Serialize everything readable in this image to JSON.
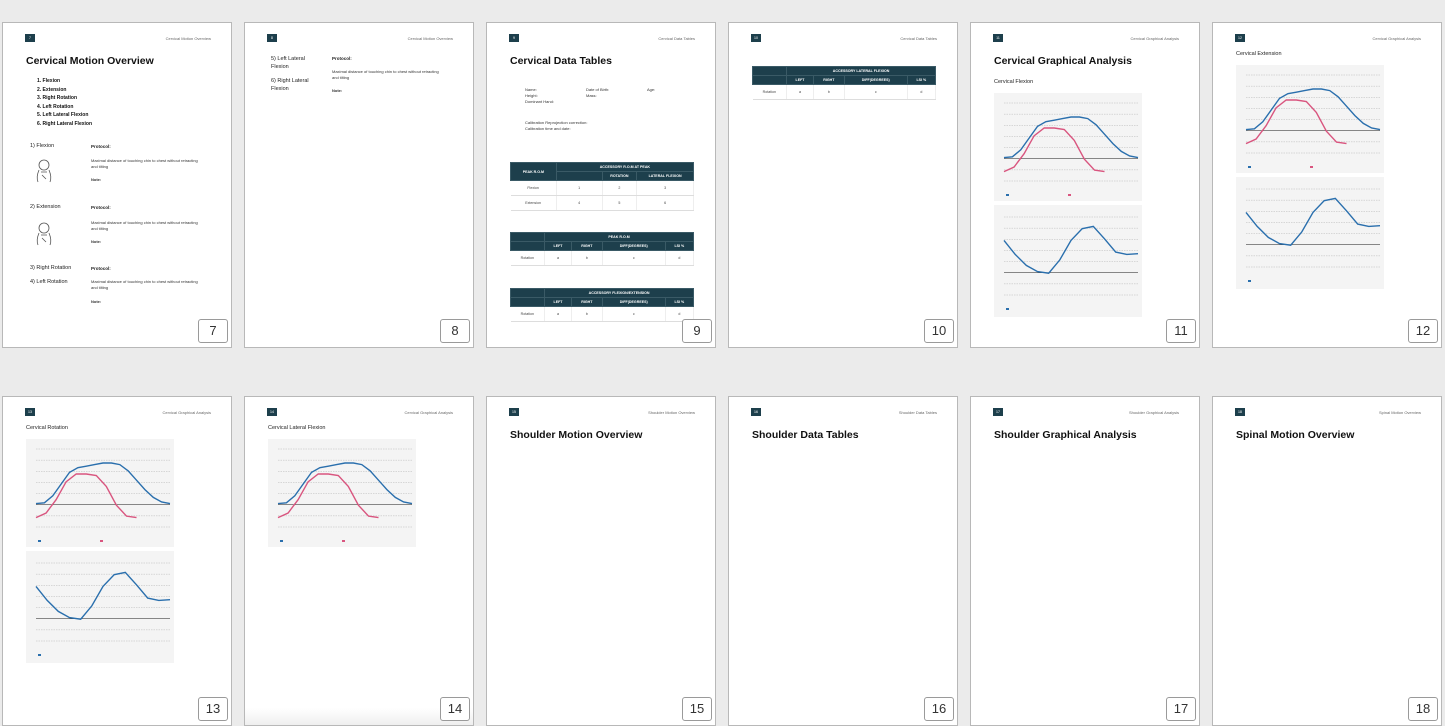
{
  "pages": [
    {
      "num": "7",
      "header": "Cervical Motion Overview",
      "title": "Cervical Motion Overview",
      "list": [
        "1.  Flexion",
        "2.  Extension",
        "3.  Right Rotation",
        "4.  Left Rotation",
        "5.  Left Lateral Flexion",
        "6.  Right Lateral Flexion"
      ],
      "sections": [
        {
          "label": "1) Flexion",
          "protocol": "Protocol:",
          "desc": "Maximal distance of touching chin to chest without retracting and tilting",
          "note": "Note:"
        },
        {
          "label": "2) Extension",
          "protocol": "Protocol:",
          "desc": "Maximal distance of touching chin to chest without retracting and tilting",
          "note": "Note:"
        },
        {
          "label": "3) Right Rotation",
          "protocol": "Protocol:"
        },
        {
          "label": "4) Left Rotation",
          "desc": "Maximal distance of touching chin to chest without retracting and tilting",
          "note": "Note:"
        }
      ]
    },
    {
      "num": "8",
      "header": "Cervical Motion Overview",
      "sections": [
        {
          "label": "5) Left Lateral Flexion",
          "protocol": "Protocol:",
          "desc": "Maximal distance of touching chin to chest without retracting and tilting"
        },
        {
          "label": "6) Right Lateral Flexion",
          "note": "Note:"
        }
      ]
    },
    {
      "num": "9",
      "header": "Cervical Data Tables",
      "title": "Cervical Data Tables",
      "info": {
        "name": "Name:",
        "height": "Height:",
        "dominant": "Dominant Hand:",
        "dob": "Date of Birth:",
        "mass": "Mass:",
        "age": "Age:",
        "calib1": "Calibration Reprojection correction:",
        "calib2": "Calibration time and date:"
      },
      "table1": {
        "h1": "PEAK R.O.M",
        "h2": "ACCESSORY R.O.M AT PEAK",
        "h3": "ROTATION",
        "h4": "LATERAL FLEXION",
        "rows": [
          [
            "Flexion",
            "1",
            "2",
            "3"
          ],
          [
            "Extension",
            "4",
            "5",
            "6"
          ]
        ]
      },
      "table2": {
        "caption": "PEAK R.O.M",
        "cols": [
          "LEFT",
          "RIGHT",
          "DIFF(DEGREES)",
          "LSI %"
        ],
        "row": [
          "Rotation",
          "a",
          "b",
          "c",
          "d"
        ]
      },
      "table3": {
        "caption": "ACCESSORY FLEXION/EXTENSION",
        "cols": [
          "LEFT",
          "RIGHT",
          "DIFF(DEGREES)",
          "LSI %"
        ],
        "row": [
          "Rotation",
          "a",
          "b",
          "c",
          "d"
        ]
      }
    },
    {
      "num": "10",
      "header": "Cervical Data Tables",
      "table": {
        "caption": "ACCESSORY LATERAL FLEXION",
        "cols": [
          "LEFT",
          "RIGHT",
          "DIFF(DEGREES)",
          "LSI %"
        ],
        "row": [
          "Rotation",
          "a",
          "b",
          "c",
          "d"
        ]
      }
    },
    {
      "num": "11",
      "header": "Cervical Graphical Analysis",
      "title": "Cervical Graphical Analysis",
      "subtitle": "Cervical Flexion"
    },
    {
      "num": "12",
      "header": "Cervical Graphical Analysis",
      "subtitle": "Cervical Extension"
    },
    {
      "num": "13",
      "header": "Cervical Graphical Analysis",
      "subtitle": "Cervical Rotation"
    },
    {
      "num": "14",
      "header": "Cervical Graphical Analysis",
      "subtitle": "Cervical Lateral Flexion"
    },
    {
      "num": "15",
      "header": "Shoulder Motion Overview",
      "title": "Shoulder Motion Overview"
    },
    {
      "num": "16",
      "header": "Shoulder Data Tables",
      "title": "Shoulder Data Tables"
    },
    {
      "num": "17",
      "header": "Shoulder Graphical Analysis",
      "title": "Shoulder Graphical Analysis"
    },
    {
      "num": "18",
      "header": "Spinal Motion Overview",
      "title": "Spinal Motion Overview"
    }
  ],
  "colors": {
    "accent": "#1d3f4c",
    "blue_series": "#2a6fad",
    "pink_series": "#d9557f"
  },
  "chart_data": [
    {
      "type": "line",
      "page": "11",
      "series": [
        {
          "values": [
            30,
            31,
            40,
            55,
            70,
            76,
            78,
            80,
            82,
            82,
            80,
            72,
            60,
            48,
            38,
            32,
            30
          ]
        },
        {
          "values": [
            12,
            18,
            35,
            58,
            68,
            68,
            66,
            52,
            28,
            14,
            12
          ]
        }
      ]
    },
    {
      "type": "line",
      "page": "11",
      "series": [
        {
          "values": [
            70,
            52,
            38,
            30,
            28,
            45,
            70,
            85,
            88,
            72,
            55,
            52,
            53
          ]
        }
      ]
    },
    {
      "type": "line",
      "page": "12",
      "series": [
        {
          "values": [
            30,
            31,
            40,
            55,
            70,
            76,
            78,
            80,
            82,
            82,
            80,
            72,
            60,
            48,
            38,
            32,
            30
          ]
        },
        {
          "values": [
            12,
            18,
            35,
            58,
            68,
            68,
            66,
            52,
            28,
            14,
            12
          ]
        }
      ]
    },
    {
      "type": "line",
      "page": "12",
      "series": [
        {
          "values": [
            70,
            52,
            38,
            30,
            28,
            45,
            70,
            85,
            88,
            72,
            55,
            52,
            53
          ]
        }
      ]
    },
    {
      "type": "line",
      "page": "13",
      "series": [
        {
          "values": [
            30,
            31,
            40,
            55,
            70,
            76,
            78,
            80,
            82,
            82,
            80,
            72,
            60,
            48,
            38,
            32,
            30
          ]
        },
        {
          "values": [
            12,
            18,
            35,
            58,
            68,
            68,
            66,
            52,
            28,
            14,
            12
          ]
        }
      ]
    },
    {
      "type": "line",
      "page": "13",
      "series": [
        {
          "values": [
            70,
            52,
            38,
            30,
            28,
            45,
            70,
            85,
            88,
            72,
            55,
            52,
            53
          ]
        }
      ]
    },
    {
      "type": "line",
      "page": "14",
      "series": [
        {
          "values": [
            30,
            31,
            40,
            55,
            70,
            76,
            78,
            80,
            82,
            82,
            80,
            72,
            60,
            48,
            38,
            32,
            30
          ]
        },
        {
          "values": [
            12,
            18,
            35,
            58,
            68,
            68,
            66,
            52,
            28,
            14,
            12
          ]
        }
      ]
    }
  ]
}
